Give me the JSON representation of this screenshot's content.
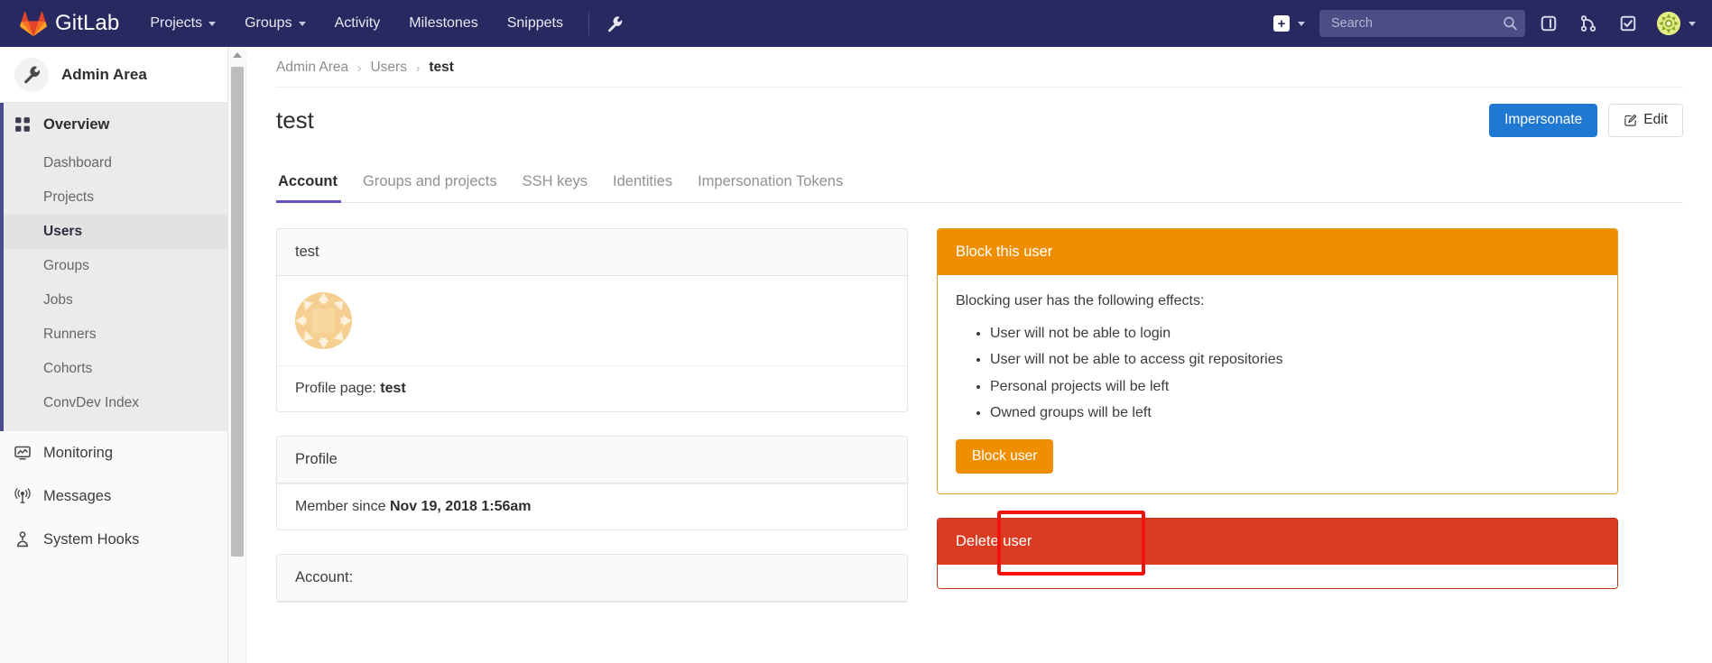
{
  "navbar": {
    "brand": "GitLab",
    "brand_logo_icon": "gitlab-tanuki-logo",
    "links": [
      {
        "label": "Projects",
        "has_caret": true
      },
      {
        "label": "Groups",
        "has_caret": true
      },
      {
        "label": "Activity",
        "has_caret": false
      },
      {
        "label": "Milestones",
        "has_caret": false
      },
      {
        "label": "Snippets",
        "has_caret": false
      }
    ],
    "admin_icon": "wrench-icon",
    "plus_icon": "plus-square-icon",
    "plus_caret_icon": "chevron-down-icon",
    "search": {
      "placeholder": "Search",
      "value": "",
      "icon": "search-icon"
    },
    "right_icons": [
      {
        "name": "issues-icon",
        "title": "Issues"
      },
      {
        "name": "merge-request-icon",
        "title": "Merge requests"
      },
      {
        "name": "todos-check-icon",
        "title": "Todos"
      }
    ],
    "avatar_icon": "user-avatar",
    "avatar_caret_icon": "chevron-down-icon",
    "colors": {
      "background": "#292961",
      "search_bg": "#4c4c86"
    }
  },
  "sidebar": {
    "context": {
      "label": "Admin Area",
      "icon": "wrench-icon"
    },
    "overview": {
      "label": "Overview",
      "icon": "grid-dots-icon"
    },
    "sub_items": [
      {
        "label": "Dashboard",
        "active": false
      },
      {
        "label": "Projects",
        "active": false
      },
      {
        "label": "Users",
        "active": true
      },
      {
        "label": "Groups",
        "active": false
      },
      {
        "label": "Jobs",
        "active": false
      },
      {
        "label": "Runners",
        "active": false
      },
      {
        "label": "Cohorts",
        "active": false
      },
      {
        "label": "ConvDev Index",
        "active": false
      }
    ],
    "items": [
      {
        "label": "Monitoring",
        "icon": "monitor-icon"
      },
      {
        "label": "Messages",
        "icon": "broadcast-icon"
      },
      {
        "label": "System Hooks",
        "icon": "hook-icon"
      }
    ],
    "active_accent": "#474d8e"
  },
  "breadcrumb": {
    "items": [
      {
        "label": "Admin Area",
        "current": false
      },
      {
        "label": "Users",
        "current": false
      },
      {
        "label": "test",
        "current": true
      }
    ],
    "separator": "›"
  },
  "header": {
    "title": "test",
    "impersonate_label": "Impersonate",
    "edit_label": "Edit",
    "edit_icon": "pencil-square-icon"
  },
  "tabs": [
    {
      "label": "Account",
      "active": true
    },
    {
      "label": "Groups and projects",
      "active": false
    },
    {
      "label": "SSH keys",
      "active": false
    },
    {
      "label": "Identities",
      "active": false
    },
    {
      "label": "Impersonation Tokens",
      "active": false
    }
  ],
  "user_card": {
    "title": "test",
    "avatar_icon": "identicon-avatar",
    "profile_page_label": "Profile page:",
    "profile_page_value": "test"
  },
  "profile_card": {
    "title": "Profile",
    "member_since_label": "Member since",
    "member_since_value": "Nov 19, 2018 1:56am"
  },
  "account_card": {
    "title": "Account:"
  },
  "block_panel": {
    "title": "Block this user",
    "intro": "Blocking user has the following effects:",
    "effects": [
      "User will not be able to login",
      "User will not be able to access git repositories",
      "Personal projects will be left",
      "Owned groups will be left"
    ],
    "button_label": "Block user",
    "header_color": "#ef8e00",
    "button_color": "#ef8e00"
  },
  "delete_panel": {
    "title": "Delete user",
    "header_color": "#db3b21"
  },
  "highlight": {
    "color": "#f4110d",
    "target": "block-user-button"
  },
  "scrollbar": {
    "up_arrow_icon": "chevron-up-icon"
  }
}
